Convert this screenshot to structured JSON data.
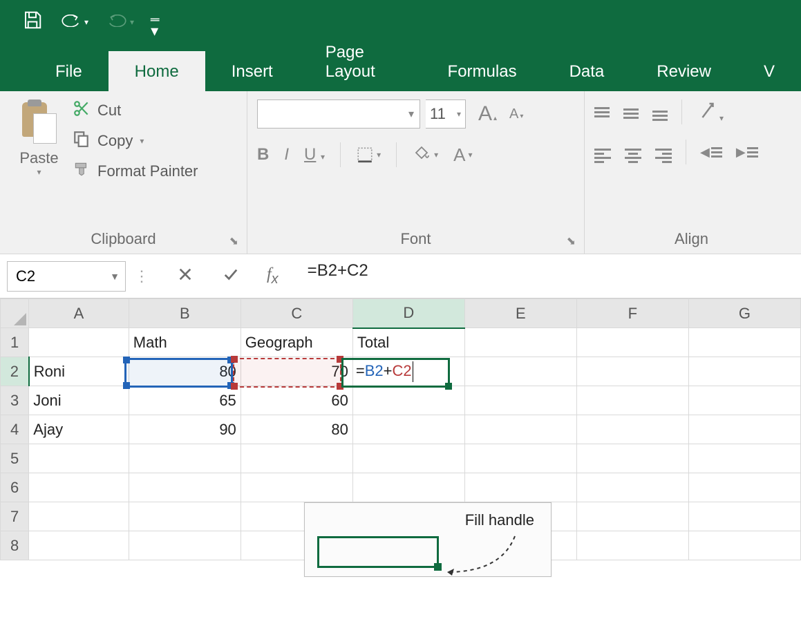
{
  "qat": {},
  "tabs": {
    "file": "File",
    "home": "Home",
    "insert": "Insert",
    "page_layout": "Page Layout",
    "formulas": "Formulas",
    "data": "Data",
    "review": "Review",
    "view_initial": "V"
  },
  "ribbon": {
    "clipboard": {
      "paste": "Paste",
      "cut": "Cut",
      "copy": "Copy",
      "format_painter": "Format Painter",
      "group_label": "Clipboard"
    },
    "font": {
      "size": "11",
      "bold": "B",
      "italic": "I",
      "underline": "U",
      "font_color_letter": "A",
      "big_a": "A",
      "small_a": "A",
      "group_label": "Font"
    },
    "alignment": {
      "group_label": "Align"
    }
  },
  "formula_bar": {
    "name_box": "C2",
    "formula": "=B2+C2"
  },
  "grid": {
    "columns": [
      "A",
      "B",
      "C",
      "D",
      "E",
      "F",
      "G"
    ],
    "rows_visible": [
      "1",
      "2",
      "3",
      "4",
      "5",
      "6",
      "7",
      "8"
    ],
    "data": {
      "1": {
        "B": "Math",
        "C": "Geography",
        "D": "Total"
      },
      "2": {
        "A": "Roni",
        "B": "80",
        "C": "70"
      },
      "3": {
        "A": "Joni",
        "B": "65",
        "C": "60"
      },
      "4": {
        "A": "Ajay",
        "B": "90",
        "C": "80"
      }
    },
    "editing_cell_formula": {
      "eq": "=",
      "ref1": "B2",
      "plus": "+",
      "ref2": "C2"
    },
    "c_header_display": "Geograph"
  },
  "callout": {
    "label": "Fill handle"
  }
}
